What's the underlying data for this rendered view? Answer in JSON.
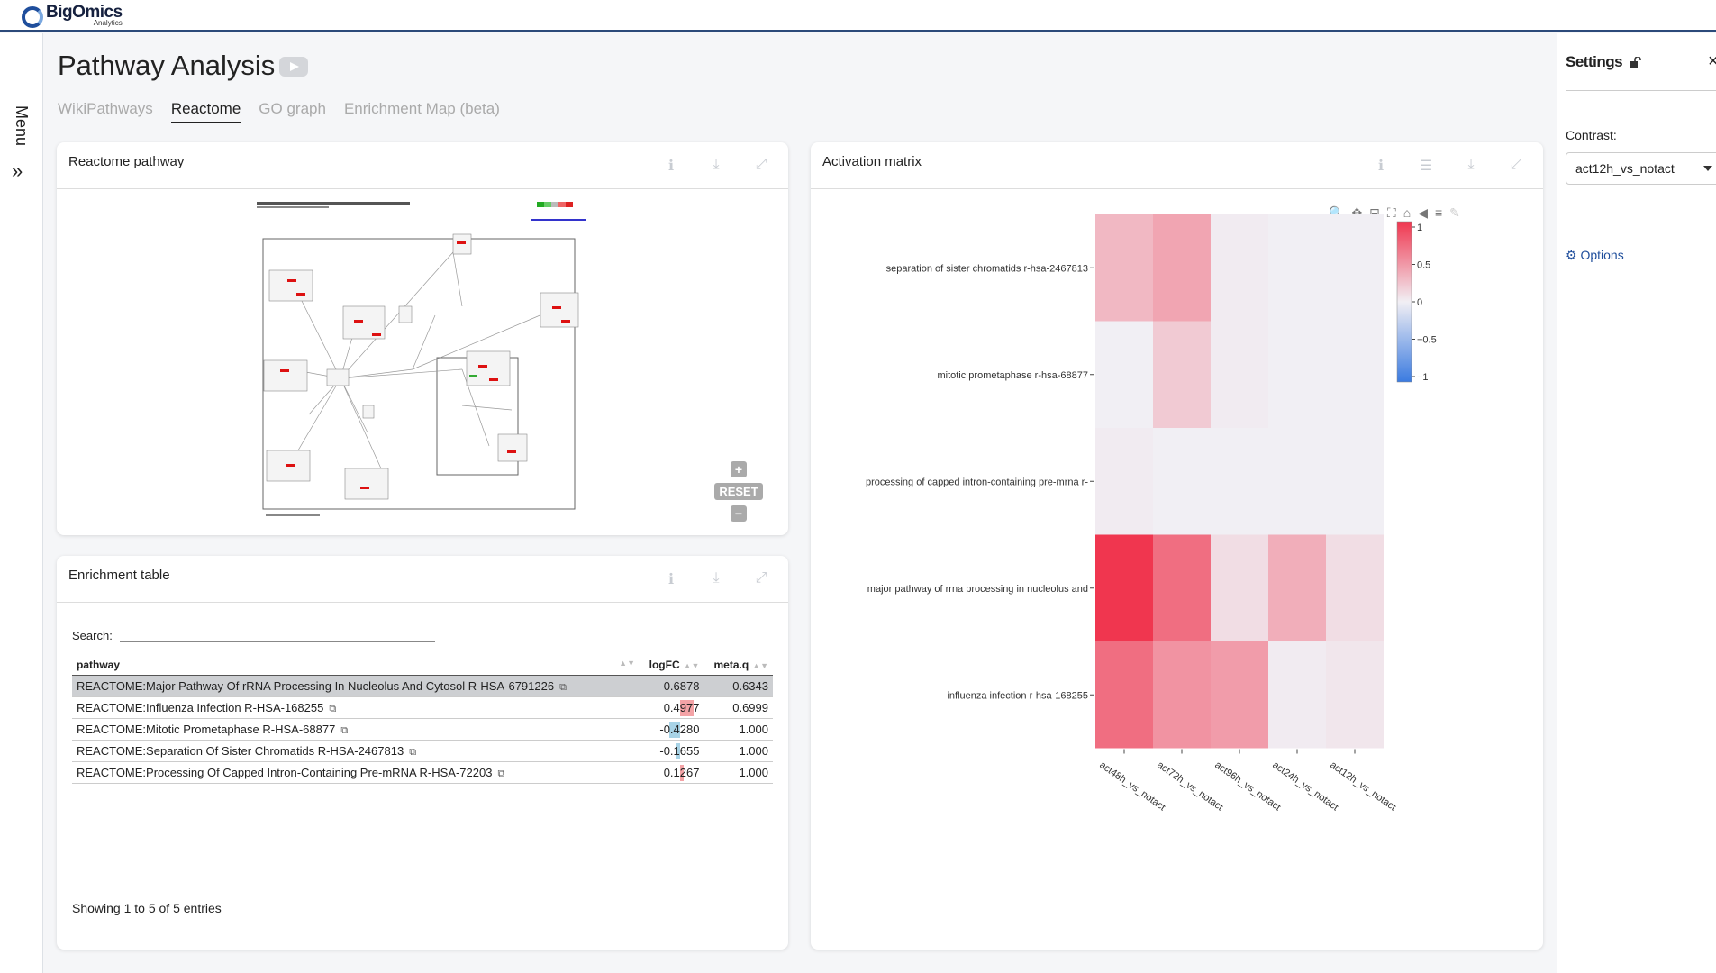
{
  "brand": {
    "name": "BigOmics",
    "sub": "Analytics"
  },
  "menu": {
    "label": "Menu",
    "chevron": "»"
  },
  "page": {
    "title": "Pathway Analysis"
  },
  "tabs": [
    {
      "label": "WikiPathways",
      "active": false
    },
    {
      "label": "Reactome",
      "active": true
    },
    {
      "label": "GO graph",
      "active": false
    },
    {
      "label": "Enrichment Map (beta)",
      "active": false
    }
  ],
  "pathway_card": {
    "title": "Reactome pathway",
    "zoom_in": "+",
    "reset": "RESET",
    "zoom_out": "−"
  },
  "enrichment_card": {
    "title": "Enrichment table",
    "search_label": "Search:",
    "search_value": "",
    "columns": [
      "pathway",
      "logFC",
      "meta.q"
    ],
    "rows": [
      {
        "pathway": "REACTOME:Major Pathway Of rRNA Processing In Nucleolus And Cytosol R-HSA-6791226",
        "logFC": "0.6878",
        "logFC_value": 0.6878,
        "metaq": "0.6343",
        "selected": true
      },
      {
        "pathway": "REACTOME:Influenza Infection R-HSA-168255",
        "logFC": "0.4977",
        "logFC_value": 0.4977,
        "metaq": "0.6999",
        "selected": false
      },
      {
        "pathway": "REACTOME:Mitotic Prometaphase R-HSA-68877",
        "logFC": "-0.4280",
        "logFC_value": -0.428,
        "metaq": "1.000",
        "selected": false
      },
      {
        "pathway": "REACTOME:Separation Of Sister Chromatids R-HSA-2467813",
        "logFC": "-0.1655",
        "logFC_value": -0.1655,
        "metaq": "1.000",
        "selected": false
      },
      {
        "pathway": "REACTOME:Processing Of Capped Intron-Containing Pre-mRNA R-HSA-72203",
        "logFC": "0.1267",
        "logFC_value": 0.1267,
        "metaq": "1.000",
        "selected": false
      }
    ],
    "showing": "Showing 1 to 5 of 5 entries"
  },
  "activation_card": {
    "title": "Activation matrix"
  },
  "colors": {
    "positive": "#f0364f",
    "negative": "#3b7be0",
    "neutral": "#f1eff4",
    "bar_pos": "#f4a3a6",
    "bar_neg": "#a8d3e6"
  },
  "chart_data": {
    "type": "heatmap",
    "rows": [
      "separation of sister chromatids r-hsa-2467813",
      "mitotic prometaphase r-hsa-68877",
      "processing of capped intron-containing pre-mrna r-",
      "major pathway of rrna processing in nucleolus and",
      "influenza infection r-hsa-168255"
    ],
    "columns": [
      "act48h_vs_notact",
      "act72h_vs_notact",
      "act96h_vs_notact",
      "act24h_vs_notact",
      "act12h_vs_notact"
    ],
    "values": [
      [
        0.3,
        0.4,
        0.02,
        0.0,
        0.0
      ],
      [
        0.0,
        0.2,
        0.02,
        0.0,
        0.0
      ],
      [
        0.02,
        0.0,
        0.0,
        0.0,
        0.0
      ],
      [
        1.0,
        0.7,
        0.1,
        0.35,
        0.1
      ],
      [
        0.7,
        0.5,
        0.45,
        0.02,
        0.05
      ]
    ],
    "colorbar": {
      "min": -1,
      "max": 1,
      "ticks": [
        "1",
        "0.5",
        "0",
        "−0.5",
        "−1"
      ]
    }
  },
  "settings": {
    "title": "Settings",
    "close": "×",
    "contrast_label": "Contrast:",
    "contrast_value": "act12h_vs_notact",
    "options_label": "Options"
  }
}
